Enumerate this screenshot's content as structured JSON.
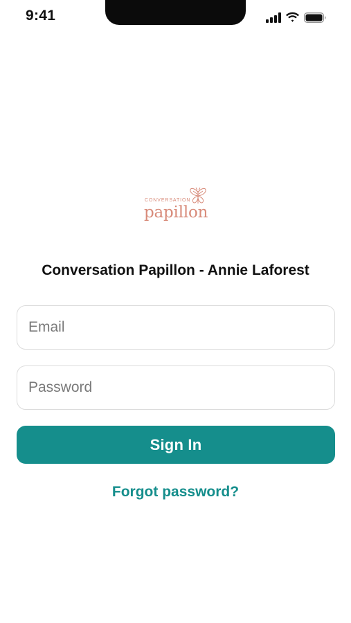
{
  "status_bar": {
    "time": "9:41",
    "icons": [
      "cellular-signal-icon",
      "wifi-icon",
      "battery-icon"
    ]
  },
  "logo": {
    "small_text": "CONVERSATION",
    "big_text": "papillon",
    "mark": "butterfly-icon"
  },
  "login": {
    "title": "Conversation Papillon - Annie Laforest",
    "email_placeholder": "Email",
    "email_value": "",
    "password_placeholder": "Password",
    "password_value": "",
    "sign_in_label": "Sign In",
    "forgot_label": "Forgot password?"
  },
  "colors": {
    "accent": "#158e8c",
    "logo": "#d88b7a",
    "field_border": "#dcdcdc",
    "text": "#111111",
    "placeholder": "#7a7a7a",
    "background": "#ffffff"
  }
}
